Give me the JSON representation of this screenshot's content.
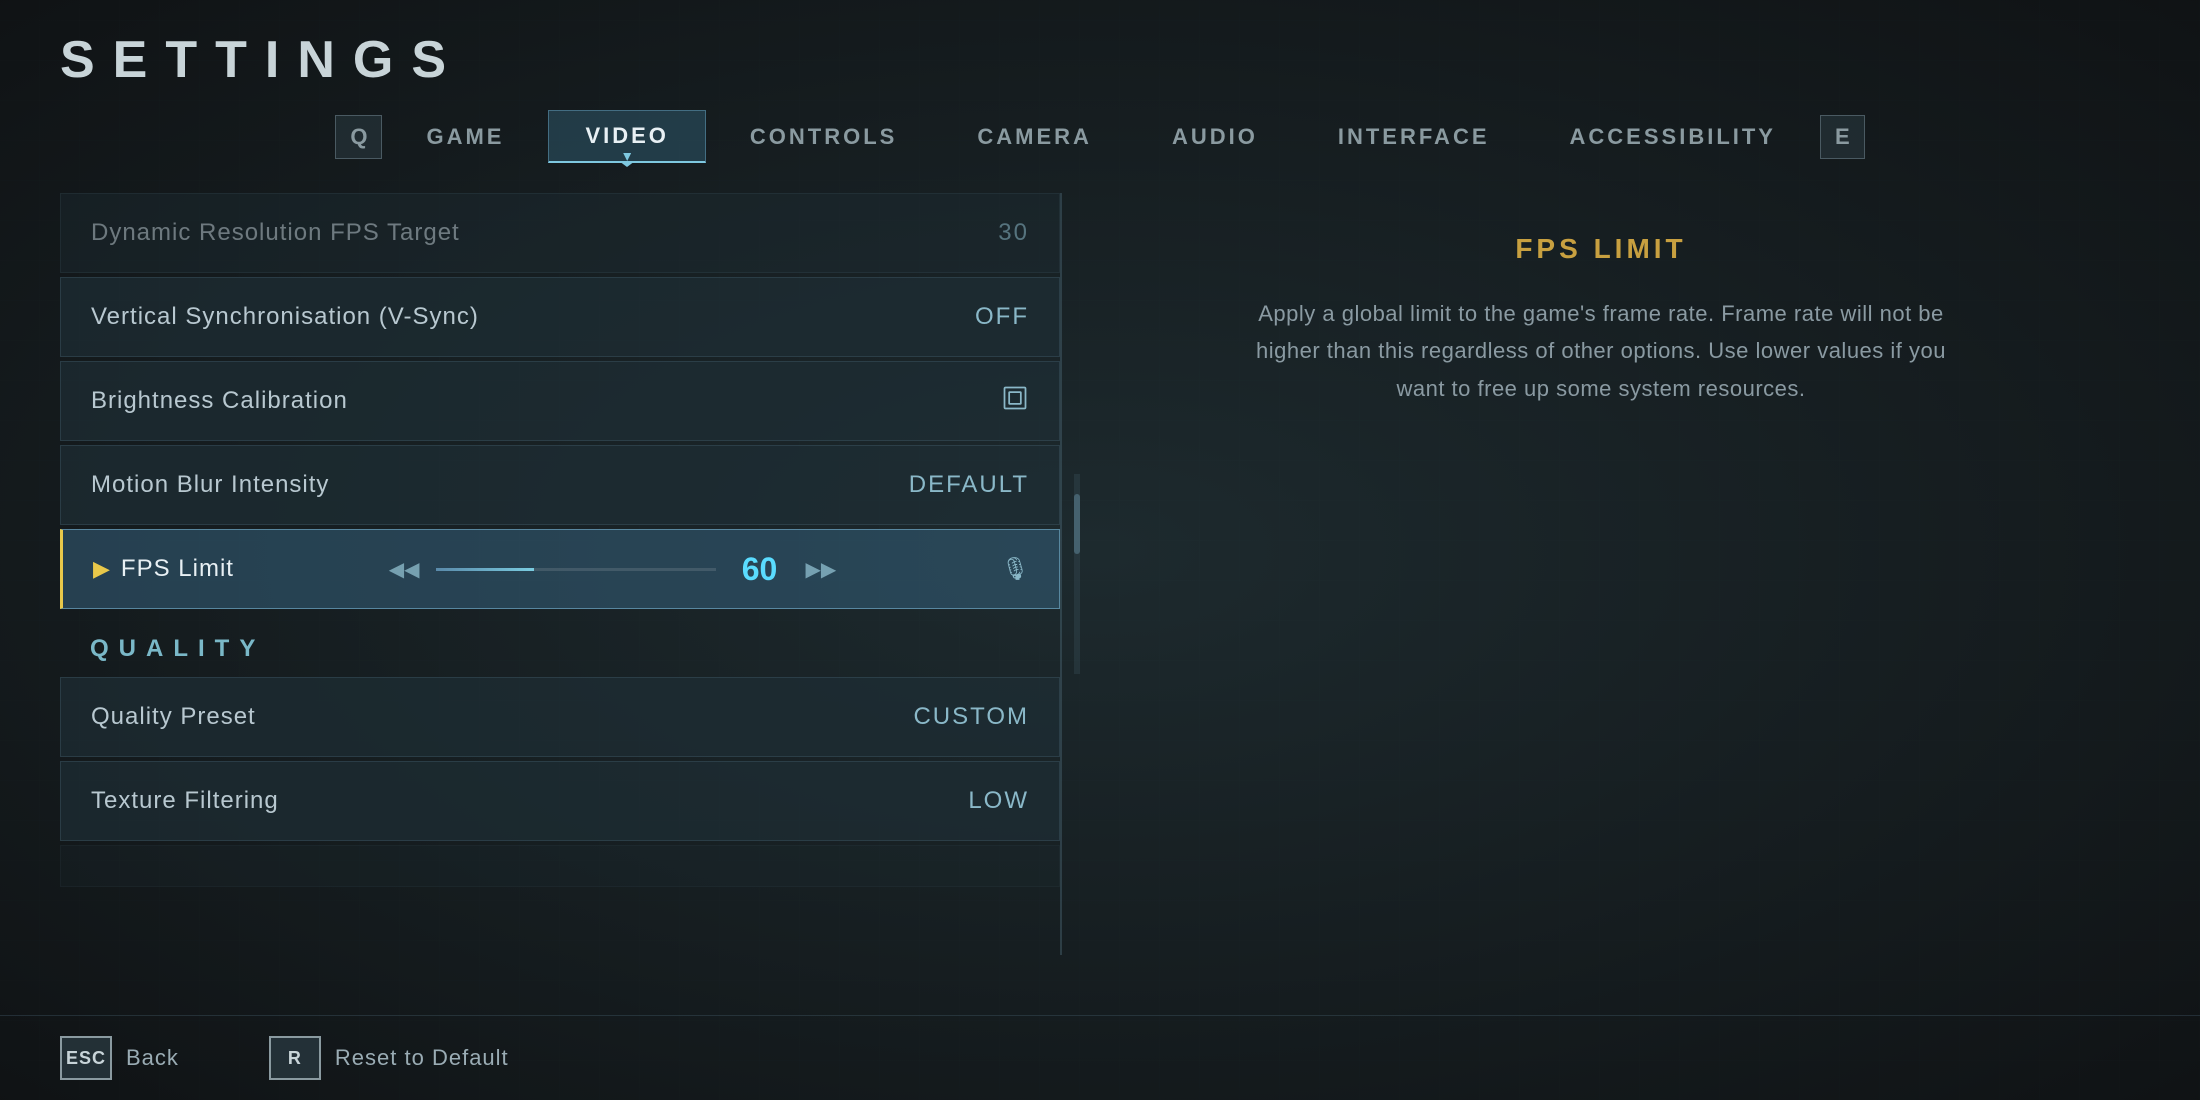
{
  "page": {
    "title": "SETTINGS"
  },
  "nav": {
    "bracket_left": "Q",
    "bracket_right": "E",
    "tabs": [
      {
        "id": "game",
        "label": "GAME",
        "active": false
      },
      {
        "id": "video",
        "label": "VIDEO",
        "active": true
      },
      {
        "id": "controls",
        "label": "CONTROLS",
        "active": false
      },
      {
        "id": "camera",
        "label": "CAMERA",
        "active": false
      },
      {
        "id": "audio",
        "label": "AUDIO",
        "active": false
      },
      {
        "id": "interface",
        "label": "INTERFACE",
        "active": false
      },
      {
        "id": "accessibility",
        "label": "ACCESSIBILITY",
        "active": false
      }
    ]
  },
  "settings": {
    "rows": [
      {
        "id": "dynamic-resolution",
        "name": "Dynamic Resolution FPS Target",
        "value": "30",
        "type": "value",
        "dimmed": true
      },
      {
        "id": "vsync",
        "name": "Vertical Synchronisation (V-Sync)",
        "value": "OFF",
        "type": "value",
        "dimmed": false
      },
      {
        "id": "brightness",
        "name": "Brightness Calibration",
        "value": "",
        "type": "icon",
        "dimmed": false
      },
      {
        "id": "motion-blur",
        "name": "Motion Blur Intensity",
        "value": "DEFAULT",
        "type": "value",
        "dimmed": false
      },
      {
        "id": "fps-limit",
        "name": "FPS Limit",
        "value": "60",
        "type": "slider",
        "active": true,
        "dimmed": false
      }
    ],
    "quality_section": {
      "header": "QUALITY",
      "rows": [
        {
          "id": "quality-preset",
          "name": "Quality Preset",
          "value": "CUSTOM",
          "type": "value"
        },
        {
          "id": "texture-filtering",
          "name": "Texture Filtering",
          "value": "LOW",
          "type": "value"
        }
      ]
    }
  },
  "info_panel": {
    "title": "FPS LIMIT",
    "description": "Apply a global limit to the game's frame rate. Frame rate will not be higher than this regardless of other options. Use lower values if you want to free up some system resources."
  },
  "footer": {
    "back_key": "ESC",
    "back_label": "Back",
    "reset_key": "R",
    "reset_label": "Reset to Default"
  }
}
